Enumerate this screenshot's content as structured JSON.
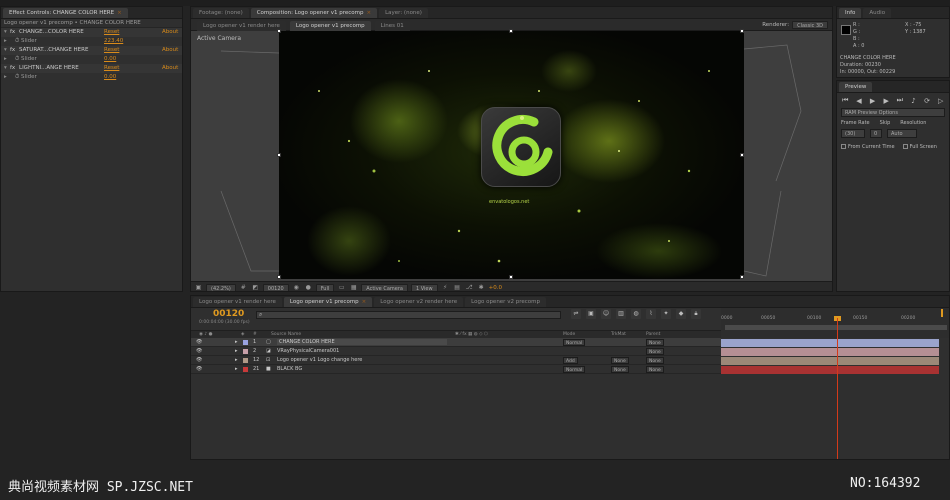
{
  "effects": {
    "tab_label": "Effect Controls: CHANGE COLOR HERE",
    "subtitle": "Logo opener v1 precomp • CHANGE COLOR HERE",
    "groups": [
      {
        "name": "CHANGE...COLOR HERE",
        "reset": "Reset",
        "about": "About",
        "slider_label": "Slider",
        "slider_value": "223.40"
      },
      {
        "name": "SATURAT...CHANGE HERE",
        "reset": "Reset",
        "about": "About",
        "slider_label": "Slider",
        "slider_value": "0.00"
      },
      {
        "name": "LIGHTNI...ANGE HERE",
        "reset": "Reset",
        "about": "About",
        "slider_label": "Slider",
        "slider_value": "0.00"
      }
    ]
  },
  "composition": {
    "tabs": [
      "Footage: (none)",
      "Composition: Logo opener v1 precomp",
      "Layer: (none)"
    ],
    "sub_tabs": [
      "Logo opener v1 render here",
      "Logo opener v1 precomp",
      "Lines 01"
    ],
    "renderer_label": "Renderer:",
    "renderer_value": "Classic 3D",
    "camera_label": "Active Camera",
    "logo_url": "envatologos.net",
    "toolbar": {
      "zoom": "(42.2%)",
      "timecode": "00120",
      "resolution": "Full",
      "camera": "Active Camera",
      "views": "1 View",
      "exposure": "+0.0"
    }
  },
  "info": {
    "tabs": [
      "Info",
      "Audio"
    ],
    "rgb": [
      "R :",
      "G :",
      "B :",
      "A : 0"
    ],
    "coords": [
      "X : -75",
      "Y : 1387"
    ],
    "layer_name": "CHANGE COLOR HERE",
    "duration": "Duration: 00230",
    "in_out": "In: 00000, Out: 00229"
  },
  "preview": {
    "title": "Preview",
    "ram_options": "RAM Preview Options",
    "frame_rate_label": "Frame Rate",
    "skip_label": "Skip",
    "resolution_label": "Resolution",
    "frame_rate_value": "(30)",
    "skip_value": "0",
    "resolution_value": "Auto",
    "from_current": "From Current Time",
    "full_screen": "Full Screen"
  },
  "timeline": {
    "tabs": [
      "Logo opener v1 render here",
      "Logo opener v1 precomp",
      "Logo opener v2 render here",
      "Logo opener v2 precomp"
    ],
    "current_time": "00120",
    "fps_label": "0:00:04:00 (30.00 fps)",
    "columns": {
      "num": "#",
      "source": "Source Name",
      "mode": "Mode",
      "trkmat": "TrkMat",
      "parent": "Parent"
    },
    "layers": [
      {
        "num": "1",
        "name": "CHANGE COLOR HERE",
        "mode": "Normal",
        "trkmat": "",
        "parent": "None",
        "color": "#9aa3e0"
      },
      {
        "num": "2",
        "name": "VRayPhysicalCamera001",
        "mode": "",
        "trkmat": "",
        "parent": "None",
        "color": "#c8a0a8"
      },
      {
        "num": "12",
        "name": "Logo opener v1 Logo change here",
        "mode": "Add",
        "trkmat": "None",
        "parent": "None",
        "color": "#b09a88"
      },
      {
        "num": "21",
        "name": "BLACK BG",
        "mode": "Normal",
        "trkmat": "None",
        "parent": "None",
        "color": "#c83a3a"
      }
    ],
    "ruler_labels": [
      "0000",
      "00050",
      "00100",
      "00150",
      "00200"
    ]
  },
  "watermark": {
    "site": "典尚视频素材网 SP.JZSC.NET",
    "id": "NO:164392"
  }
}
